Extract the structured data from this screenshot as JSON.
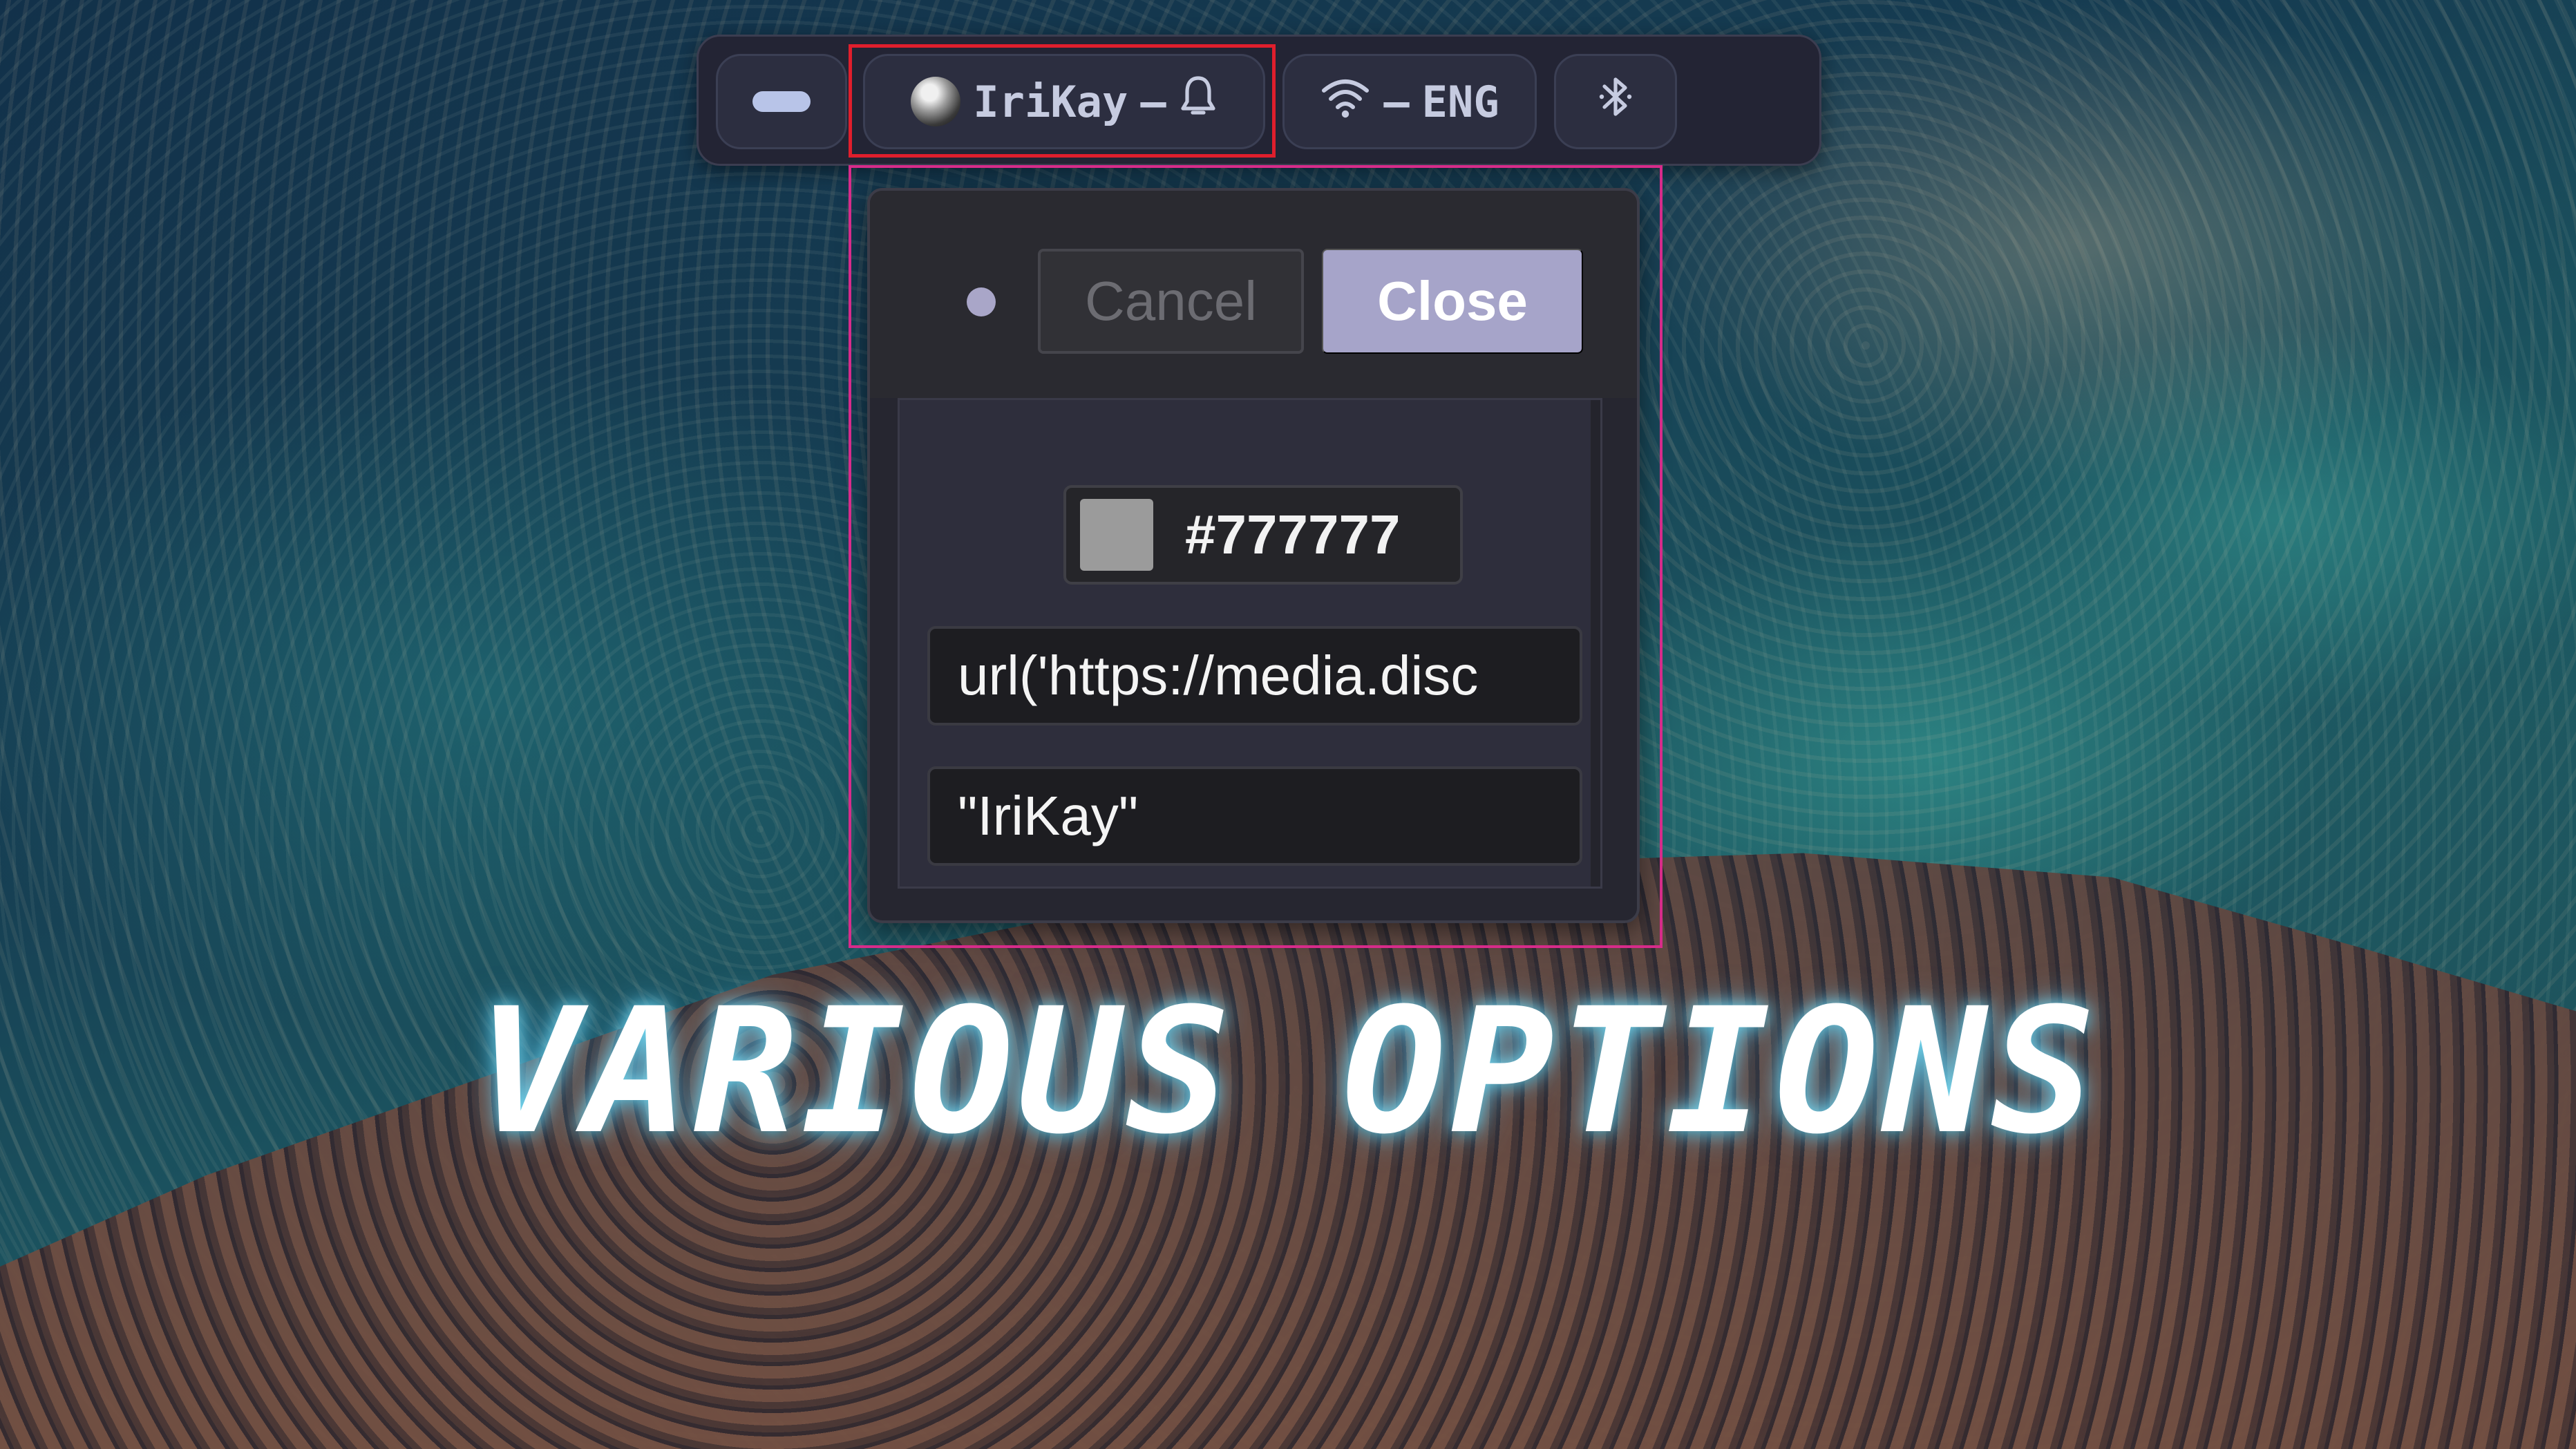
{
  "topbar": {
    "workspace_icon": "workspace-pill-icon",
    "user": {
      "avatar_icon": "sphere-avatar-icon",
      "name": "IriKay",
      "separator": "–",
      "bell_icon": "bell-icon"
    },
    "network": {
      "wifi_icon": "wifi-icon",
      "separator": "–",
      "language": "ENG"
    },
    "bluetooth_icon": "bluetooth-icon"
  },
  "popup": {
    "status_dot_color": "#a9a6c8",
    "cancel_label": "Cancel",
    "close_label": "Close",
    "color_field": {
      "swatch_color": "#9b9b9b",
      "value": "#777777"
    },
    "background_field": {
      "value": "url('https://media.disc"
    },
    "name_field": {
      "value": "\"IriKay\""
    }
  },
  "caption": "VARIOUS OPTIONS",
  "colors": {
    "highlight_red": "#e01e2c",
    "highlight_pink": "#d72b8a",
    "close_button": "#a6a4c9"
  }
}
